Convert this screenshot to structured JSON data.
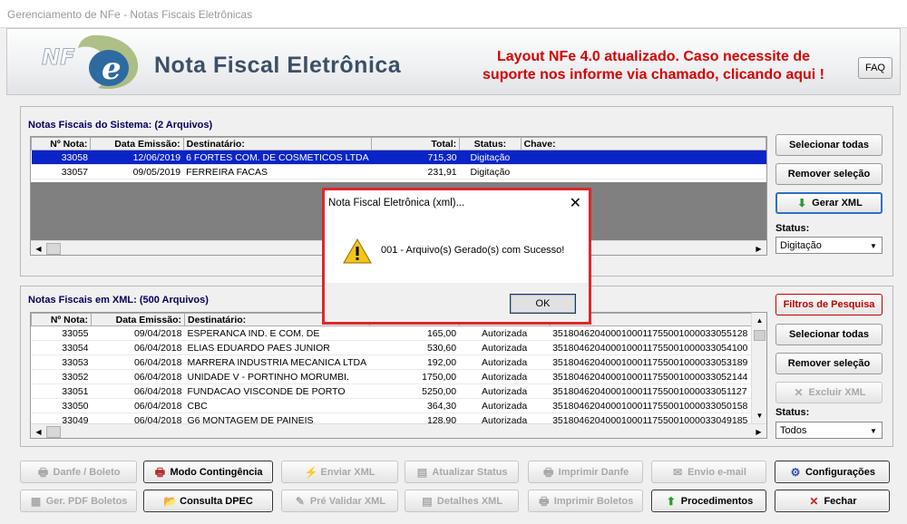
{
  "window": {
    "title": "Gerenciamento de NFe - Notas Fiscais Eletrônicas"
  },
  "banner": {
    "logo_text": "NFe",
    "title": "Nota Fiscal Eletrônica",
    "notice_line1": "Layout NFe 4.0 atualizado. Caso necessite de",
    "notice_line2": "suporte nos informe via chamado, clicando aqui !",
    "faq": "FAQ"
  },
  "system_panel": {
    "title": "Notas Fiscais do Sistema: (2 Arquivos)",
    "columns": {
      "num": "Nº Nota:",
      "date": "Data Emissão:",
      "dest": "Destinatário:",
      "total": "Total:",
      "status": "Status:",
      "key": "Chave:"
    },
    "rows": [
      {
        "num": "33058",
        "date": "12/06/2019",
        "dest": "6 FORTES COM. DE COSMETICOS LTDA",
        "total": "715,30",
        "status": "Digitação",
        "key": "",
        "selected": true
      },
      {
        "num": "33057",
        "date": "09/05/2019",
        "dest": "FERREIRA FACAS",
        "total": "231,91",
        "status": "Digitação",
        "key": "",
        "selected": false
      }
    ],
    "buttons": {
      "select_all": "Selecionar todas",
      "remove_sel": "Remover seleção",
      "gen_xml": "Gerar XML"
    },
    "status_label": "Status:",
    "status_value": "Digitação"
  },
  "xml_panel": {
    "title": "Notas Fiscais em XML: (500 Arquivos)",
    "columns": {
      "num": "Nº Nota:",
      "date": "Data Emissão:",
      "dest": "Destinatário:",
      "total": "",
      "status": "",
      "key": ""
    },
    "rows": [
      {
        "num": "33055",
        "date": "09/04/2018",
        "dest": "ESPERANCA IND. E COM. DE",
        "total": "165,00",
        "status": "Autorizada",
        "key": "3518046204000100011755001000033055128"
      },
      {
        "num": "33054",
        "date": "06/04/2018",
        "dest": "ELIAS EDUARDO PAES JUNIOR",
        "total": "530,60",
        "status": "Autorizada",
        "key": "3518046204000100011755001000033054100"
      },
      {
        "num": "33053",
        "date": "06/04/2018",
        "dest": "MARRERA INDUSTRIA MECANICA LTDA",
        "total": "192,00",
        "status": "Autorizada",
        "key": "3518046204000100011755001000033053189"
      },
      {
        "num": "33052",
        "date": "06/04/2018",
        "dest": "UNIDADE V - PORTINHO MORUMBI.",
        "total": "1750,00",
        "status": "Autorizada",
        "key": "3518046204000100011755001000033052144"
      },
      {
        "num": "33051",
        "date": "06/04/2018",
        "dest": "FUNDACAO VISCONDE DE PORTO",
        "total": "5250,00",
        "status": "Autorizada",
        "key": "3518046204000100011755001000033051127"
      },
      {
        "num": "33050",
        "date": "06/04/2018",
        "dest": "CBC",
        "total": "364,30",
        "status": "Autorizada",
        "key": "3518046204000100011755001000033050158"
      },
      {
        "num": "33049",
        "date": "06/04/2018",
        "dest": "G6 MONTAGEM DE PAINEIS",
        "total": "128,90",
        "status": "Autorizada",
        "key": "3518046204000100011755001000033049185"
      }
    ],
    "buttons": {
      "filters": "Filtros de Pesquisa",
      "select_all": "Selecionar todas",
      "remove_sel": "Remover seleção",
      "delete_xml": "Excluir XML"
    },
    "status_label": "Status:",
    "status_value": "Todos"
  },
  "bottom_buttons": {
    "danfe_boleto": "Danfe / Boleto",
    "contingencia": "Modo Contingência",
    "enviar_xml": "Enviar XML",
    "atualizar_status": "Atualizar Status",
    "imprimir_danfe": "Imprimir Danfe",
    "envio_email": "Envio e-mail",
    "configuracoes": "Configurações",
    "ger_pdf": "Ger. PDF Boletos",
    "consulta_dpec": "Consulta DPEC",
    "pre_validar": "Pré Validar XML",
    "detalhes_xml": "Detalhes XML",
    "imprimir_boletos": "Imprimir Boletos",
    "procedimentos": "Procedimentos",
    "fechar": "Fechar"
  },
  "dialog": {
    "title": "Nota Fiscal Eletrônica (xml)...",
    "message": "001 - Arquivo(s) Gerado(s) com Sucesso!",
    "ok": "OK",
    "close": "✕"
  },
  "colors": {
    "selection": "#0a24c8",
    "notice": "#d80000",
    "title": "#3d4f66",
    "panel_title": "#000060",
    "dialog_border": "#e0262c"
  }
}
